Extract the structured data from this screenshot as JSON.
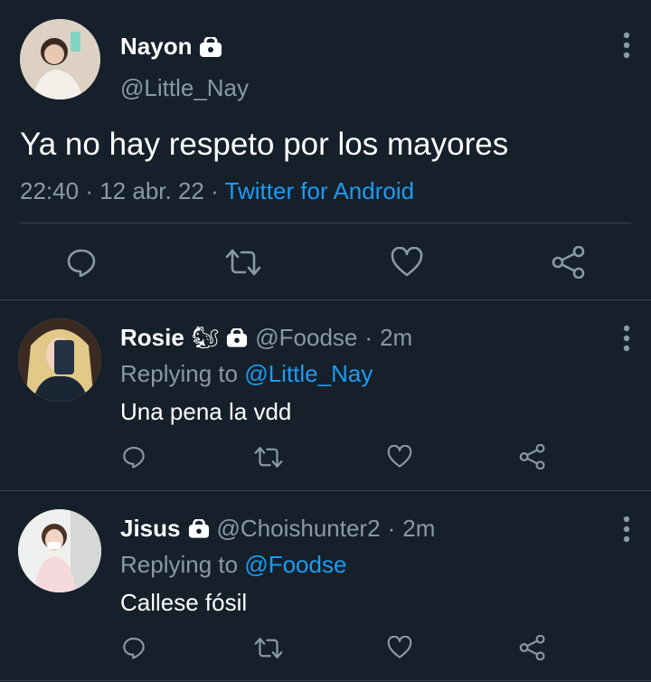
{
  "main_tweet": {
    "name": "Nayon",
    "handle": "@Little_Nay",
    "text": "Ya no hay respeto por los mayores",
    "time": "22:40",
    "date": "12 abr. 22",
    "source": "Twitter for Android",
    "icons": [
      "lock-icon",
      "more-vertical-icon",
      "reply-icon",
      "retweet-icon",
      "like-icon",
      "share-icon"
    ]
  },
  "replies": [
    {
      "name": "Rosie",
      "emoji": "🐿",
      "handle": "@Foodse",
      "time": "2m",
      "replying_label": "Replying to",
      "replying_to": "@Little_Nay",
      "text": "Una pena la vdd"
    },
    {
      "name": "Jisus",
      "handle": "@Choishunter2",
      "time": "2m",
      "replying_label": "Replying to",
      "replying_to": "@Foodse",
      "text": "Callese fósil"
    }
  ],
  "separator": "·",
  "colors": {
    "background": "#15202b",
    "text": "#ffffff",
    "muted": "#8b98a5",
    "link": "#1d9bf0",
    "divider": "#38444d"
  }
}
